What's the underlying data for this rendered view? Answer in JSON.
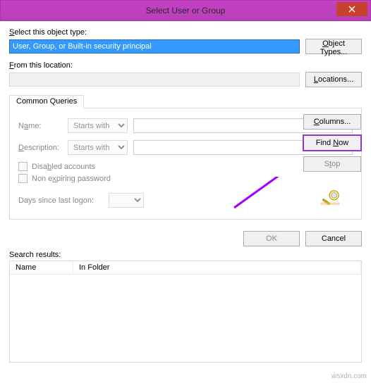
{
  "window": {
    "title": "Select User or Group"
  },
  "labels": {
    "object_type": "Select this object type:",
    "from_location": "From this location:",
    "search_results": "Search results:"
  },
  "fields": {
    "object_type_value": "User, Group, or Built-in security principal",
    "location_value": ""
  },
  "buttons": {
    "object_types": "Object Types...",
    "locations": "Locations...",
    "columns": "Columns...",
    "find_now": "Find Now",
    "stop": "Stop",
    "ok": "OK",
    "cancel": "Cancel"
  },
  "tab": {
    "common_queries": "Common Queries"
  },
  "queries": {
    "name_label": "Name:",
    "desc_label": "Description:",
    "starts_with": "Starts with",
    "disabled": "Disabled accounts",
    "non_expiring": "Non expiring password",
    "days_since": "Days since last logon:"
  },
  "columns": {
    "name": "Name",
    "in_folder": "In Folder"
  },
  "watermark": "wsxdn.com"
}
